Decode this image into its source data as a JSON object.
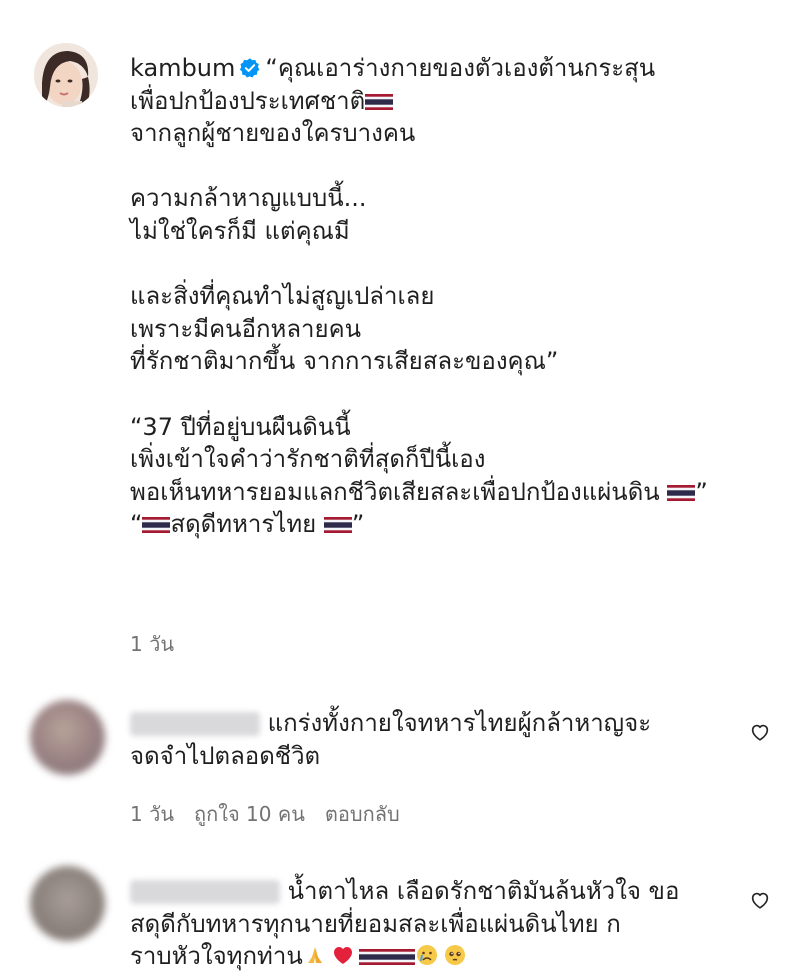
{
  "main_comment": {
    "username": "kambum",
    "lines": [
      "“คุณเอาร่างกายของตัวเองต้านกระสุน",
      "เพื่อปกป้องประเทศชาติ",
      "จากลูกผู้ชายของใครบางคน",
      "",
      "ความกล้าหาญแบบนี้...",
      "ไม่ใช่ใครก็มี แต่คุณมี",
      "",
      "และสิ่งที่คุณทำไม่สูญเปล่าเลย",
      "เพราะมีคนอีกหลายคน",
      "ที่รักชาติมากขึ้น จากการเสียสละของคุณ”",
      "",
      "“37 ปีที่อยู่บนผืนดินนี้",
      "เพิ่งเข้าใจคำว่ารักชาติที่สุดก็ปีนี้เอง",
      "พอเห็นทหารยอมแลกชีวิตเสียสละเพื่อปกป้องแผ่นดิน",
      "สดุดีทหารไทย"
    ],
    "time": "1 วัน"
  },
  "replies": [
    {
      "text_line1": "แกร่งทั้งกายใจทหารไทยผู้กล้าหาญจะ",
      "text_line2": "จดจำไปตลอดชีวิต",
      "time": "1 วัน",
      "likes": "ถูกใจ 10 คน",
      "reply_label": "ตอบกลับ"
    },
    {
      "text_line1": "น้ำตาไหล เลือดรักชาติมันล้นหัวใจ ขอ",
      "text_line2": "สดุดีกับทหารทุกนายที่ยอมสละเพื่อแผ่นดินไทย ก",
      "text_line3": "ราบหัวใจทุกท่าน"
    }
  ],
  "icons": [
    "verified-badge-icon",
    "thai-flag-icon",
    "heart-icon",
    "praying-hands-emoji",
    "red-heart-emoji",
    "crying-face-emoji"
  ],
  "colors": {
    "verified": "#0095f6",
    "meta_text": "#737373",
    "text": "#1f1f1f"
  }
}
